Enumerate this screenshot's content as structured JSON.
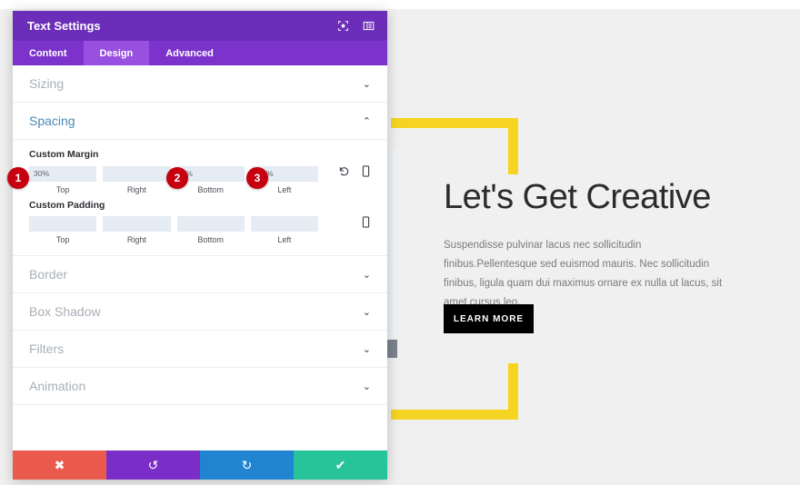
{
  "panel": {
    "title": "Text Settings",
    "header_icons": [
      {
        "name": "focus-target-icon"
      },
      {
        "name": "panel-layout-icon"
      }
    ],
    "tabs": [
      {
        "label": "Content",
        "active": false
      },
      {
        "label": "Design",
        "active": true
      },
      {
        "label": "Advanced",
        "active": false
      }
    ],
    "sections": [
      {
        "label": "Sizing",
        "open": false,
        "chevron": "⌄"
      },
      {
        "label": "Spacing",
        "open": true,
        "chevron": "⌃"
      },
      {
        "label": "Border",
        "open": false,
        "chevron": "⌄"
      },
      {
        "label": "Box Shadow",
        "open": false,
        "chevron": "⌄"
      },
      {
        "label": "Filters",
        "open": false,
        "chevron": "⌄"
      },
      {
        "label": "Animation",
        "open": false,
        "chevron": "⌄"
      }
    ],
    "spacing": {
      "margin_label": "Custom Margin",
      "padding_label": "Custom Padding",
      "margin": {
        "top": {
          "value": "30%",
          "sub": "Top"
        },
        "right": {
          "value": "",
          "sub": "Right"
        },
        "bottom": {
          "value": "2%",
          "sub": "Bottom"
        },
        "left": {
          "value": "-37%",
          "sub": "Left"
        }
      },
      "padding": {
        "top": {
          "value": "",
          "sub": "Top"
        },
        "right": {
          "value": "",
          "sub": "Right"
        },
        "bottom": {
          "value": "",
          "sub": "Bottom"
        },
        "left": {
          "value": "",
          "sub": "Left"
        }
      },
      "placeholder": ""
    },
    "markers": [
      {
        "number": "1"
      },
      {
        "number": "2"
      },
      {
        "number": "3"
      }
    ],
    "footer": [
      {
        "name": "cancel-button",
        "glyph": "✖"
      },
      {
        "name": "undo-button",
        "glyph": "↺"
      },
      {
        "name": "redo-button",
        "glyph": "↻"
      },
      {
        "name": "save-button",
        "glyph": "✔"
      }
    ]
  },
  "preview": {
    "title": "Let's Get Creative",
    "paragraph": "Suspendisse pulvinar lacus nec sollicitudin finibus.Pellentesque sed euismod mauris. Nec sollicitudin finibus, ligula quam dui maximus ornare ex nulla ut lacus, sit amet cursus leo.",
    "button_label": "LEARN MORE"
  },
  "colors": {
    "panel_header": "#6c2eb9",
    "tab_bar": "#7b33cc",
    "tab_active": "#9850e0",
    "accent_blue": "#4b8ab5",
    "marker_red": "#c7000f",
    "bracket_yellow": "#f5d521",
    "page_bg": "#f0f0f0",
    "cancel": "#eb5b4d",
    "undo": "#7a2ec7",
    "redo": "#2084d0",
    "save": "#27c39a"
  }
}
